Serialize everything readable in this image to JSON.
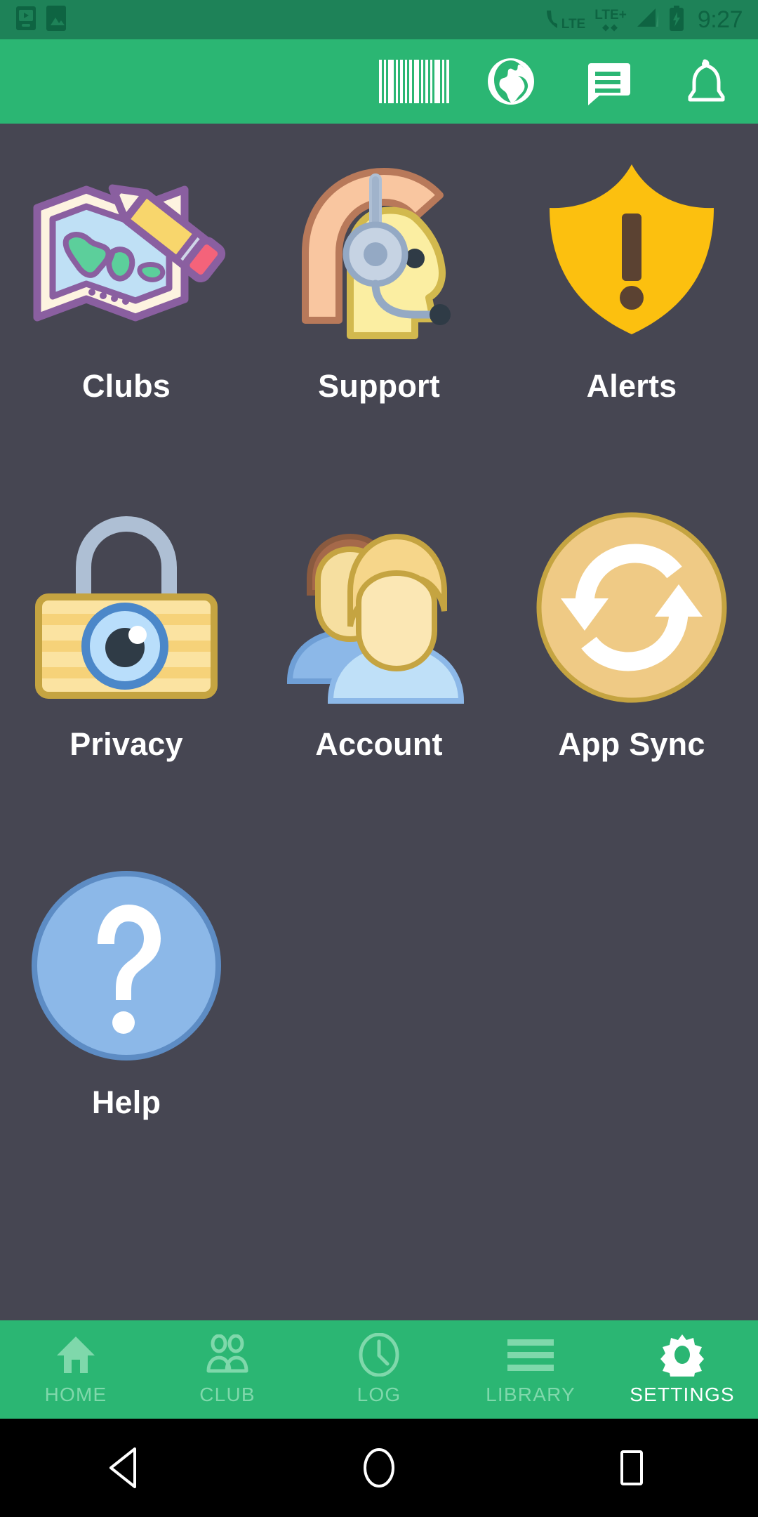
{
  "theme": {
    "status_bar_bg": "#1e8258",
    "status_bar_fg": "#0e6442",
    "app_bar_bg": "#2bb673",
    "content_bg": "#464652",
    "nav_bg": "#2bb673",
    "nav_inactive": "#7fd8ab",
    "nav_active": "#ffffff",
    "label_color": "#ffffff"
  },
  "status_bar": {
    "time": "9:27",
    "network_primary": "LTE",
    "network_secondary": "LTE+",
    "left_icons": [
      {
        "name": "cast-screen-icon"
      },
      {
        "name": "image-photo-icon"
      }
    ],
    "right_icons": [
      {
        "name": "phone-lte-icon"
      },
      {
        "name": "signal-lte-plus-icon"
      },
      {
        "name": "signal-bars-icon"
      },
      {
        "name": "battery-charging-icon"
      }
    ]
  },
  "app_bar": {
    "actions": [
      {
        "name": "barcode-icon",
        "label": "Barcode"
      },
      {
        "name": "globe-icon",
        "label": "Globe"
      },
      {
        "name": "message-icon",
        "label": "Messages"
      },
      {
        "name": "bell-icon",
        "label": "Notifications"
      }
    ]
  },
  "grid": {
    "items": [
      {
        "id": "clubs",
        "label": "Clubs",
        "icon": "map-pencil-icon"
      },
      {
        "id": "support",
        "label": "Support",
        "icon": "headset-person-icon"
      },
      {
        "id": "alerts",
        "label": "Alerts",
        "icon": "shield-warning-icon"
      },
      {
        "id": "privacy",
        "label": "Privacy",
        "icon": "padlock-eye-icon"
      },
      {
        "id": "account",
        "label": "Account",
        "icon": "two-people-icon"
      },
      {
        "id": "app_sync",
        "label": "App Sync",
        "icon": "sync-arrows-icon"
      },
      {
        "id": "help",
        "label": "Help",
        "icon": "question-mark-circle-icon"
      }
    ]
  },
  "bottom_nav": {
    "items": [
      {
        "id": "home",
        "label": "HOME",
        "icon": "home-icon",
        "active": false
      },
      {
        "id": "club",
        "label": "CLUB",
        "icon": "people-icon",
        "active": false
      },
      {
        "id": "log",
        "label": "LOG",
        "icon": "clock-icon",
        "active": false
      },
      {
        "id": "library",
        "label": "LIBRARY",
        "icon": "list-icon",
        "active": false
      },
      {
        "id": "settings",
        "label": "SETTINGS",
        "icon": "gear-icon",
        "active": true
      }
    ]
  },
  "android_nav": {
    "buttons": [
      {
        "id": "back",
        "name": "back-triangle-icon"
      },
      {
        "id": "home",
        "name": "home-circle-icon"
      },
      {
        "id": "recents",
        "name": "recents-square-icon"
      }
    ]
  }
}
